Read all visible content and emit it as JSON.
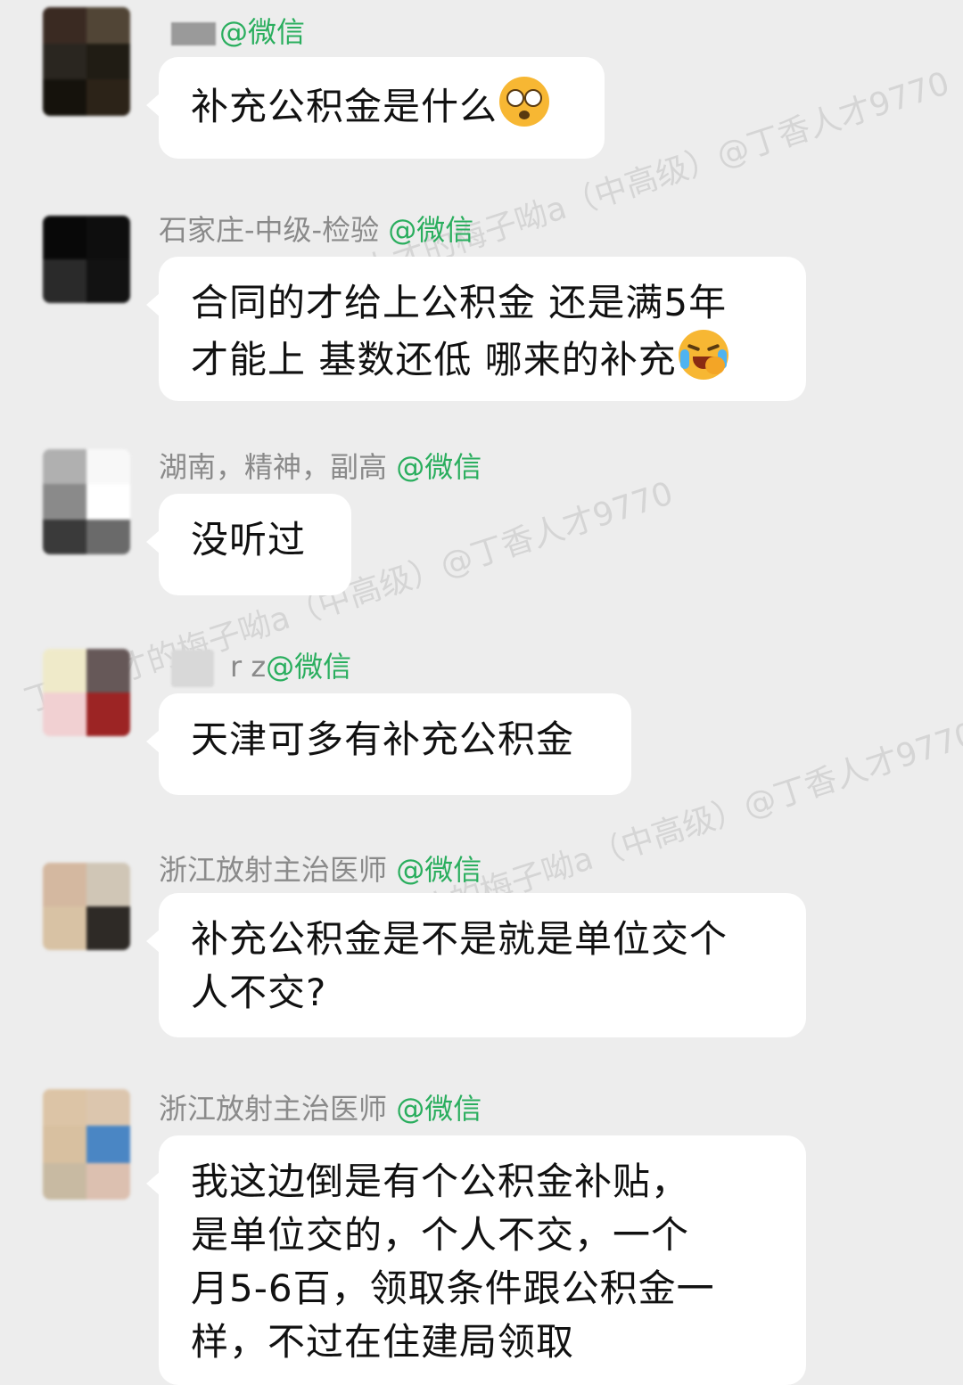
{
  "watermark_text": "丁香人才的梅子呦a（中高级）@丁香人才9770",
  "messages": [
    {
      "sender": "",
      "platform": "@微信",
      "text": "补充公积金是什么",
      "emoji": "shocked-face-icon"
    },
    {
      "sender": "石家庄-中级-检验",
      "platform": "@微信",
      "line1": "合同的才给上公积金 还是满5年",
      "line2": "才能上 基数还低 哪来的补充",
      "emoji": "crying-laughing-face-icon"
    },
    {
      "sender": "湖南，精神，副高",
      "platform": "@微信",
      "text": "没听过"
    },
    {
      "sender": "r  z",
      "platform": "@微信",
      "text": "天津可多有补充公积金"
    },
    {
      "sender": "浙江放射主治医师",
      "platform": "@微信",
      "line1": "补充公积金是不是就是单位交个",
      "line2": "人不交?"
    },
    {
      "sender": "浙江放射主治医师",
      "platform": "@微信",
      "line1": "我这边倒是有个公积金补贴，",
      "line2": "是单位交的，个人不交，一个",
      "line3": "月5-6百，领取条件跟公积金一",
      "line4": "样，不过在住建局领取"
    }
  ]
}
